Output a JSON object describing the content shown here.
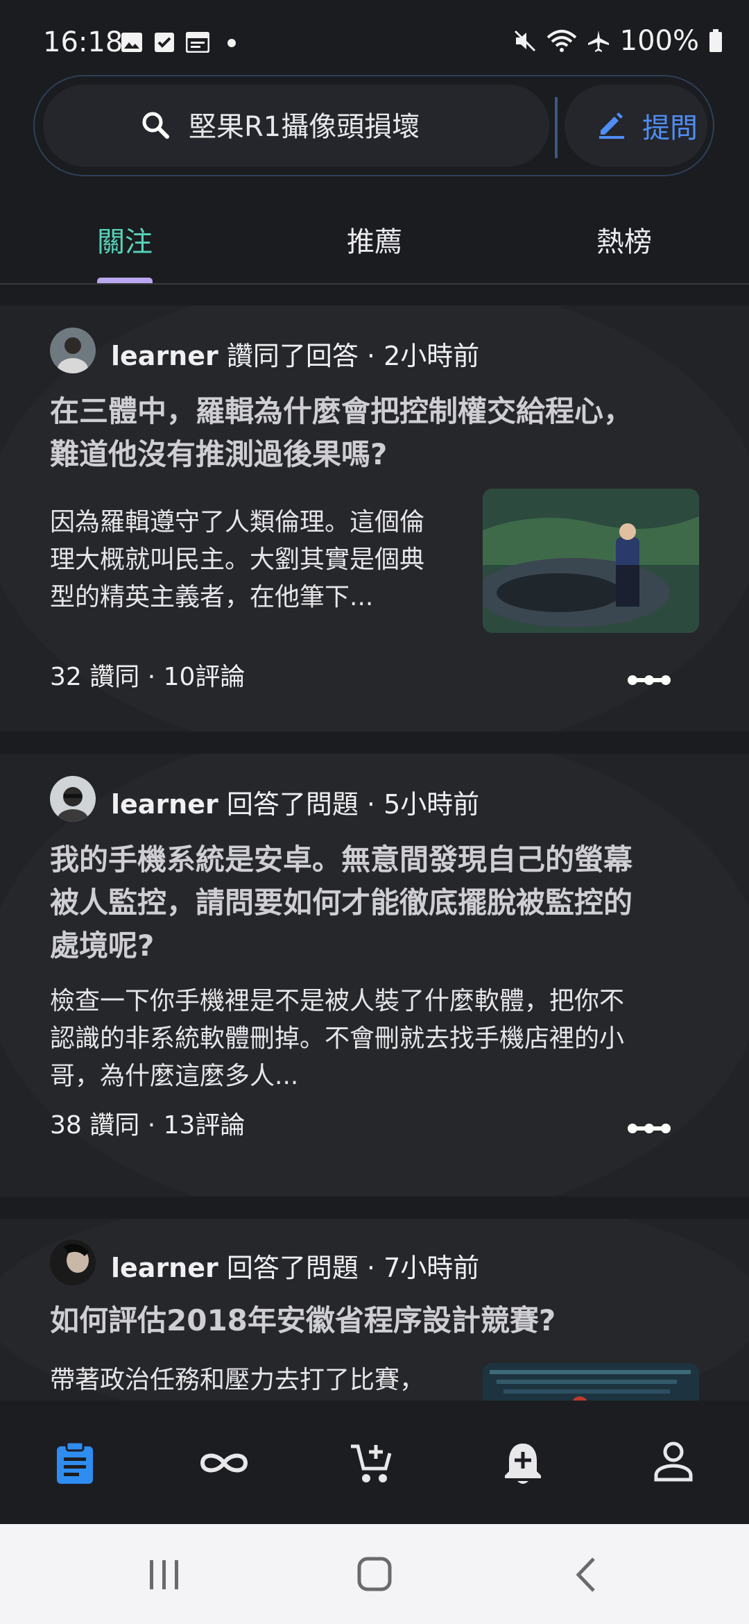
{
  "status_bar": {
    "time": "16:18",
    "battery": "100%"
  },
  "search": {
    "query": "堅果R1攝像頭損壞",
    "ask_label": "提問"
  },
  "tabs": [
    {
      "label": "關注",
      "active": true
    },
    {
      "label": "推薦",
      "active": false
    },
    {
      "label": "熱榜",
      "active": false
    }
  ],
  "feed": [
    {
      "user": "learner",
      "action": " 讚同了回答 · 2小時前",
      "title_line1": "在三體中，羅輯為什麼會把控制權交給程心，",
      "title_line2": "難道他沒有推測過後果嗎?",
      "excerpt_line1": "因為羅輯遵守了人類倫理。這個倫",
      "excerpt_line2": "理大概就叫民主。大劉其實是個典",
      "excerpt_line3": "型的精英主義者，在他筆下...",
      "stats": "32 讚同 · 10評論"
    },
    {
      "user": "learner",
      "action": " 回答了問題 · 5小時前",
      "title_line1": "我的手機系統是安卓。無意間發現自己的螢幕",
      "title_line2": "被人監控，請問要如何才能徹底擺脫被監控的",
      "title_line3": "處境呢?",
      "excerpt_line1": "檢查一下你手機裡是不是被人裝了什麼軟體，把你不",
      "excerpt_line2": "認識的非系統軟體刪掉。不會刪就去找手機店裡的小",
      "excerpt_line3": "哥，為什麼這麼多人...",
      "stats": "38 讚同 · 13評論"
    },
    {
      "user": "learner",
      "action": " 回答了問題 · 7小時前",
      "title_line1": "如何評估2018年安徽省程序設計競賽?",
      "excerpt_line1": "帶著政治任務和壓力去打了比賽，"
    }
  ],
  "bottom_nav": [
    "clipboard-icon",
    "infinity-icon",
    "cart-add-icon",
    "bell-add-icon",
    "person-icon"
  ],
  "colors": {
    "accent": "#58d3b8",
    "link": "#4f8ef7",
    "nav_active": "#2f8cf0"
  }
}
